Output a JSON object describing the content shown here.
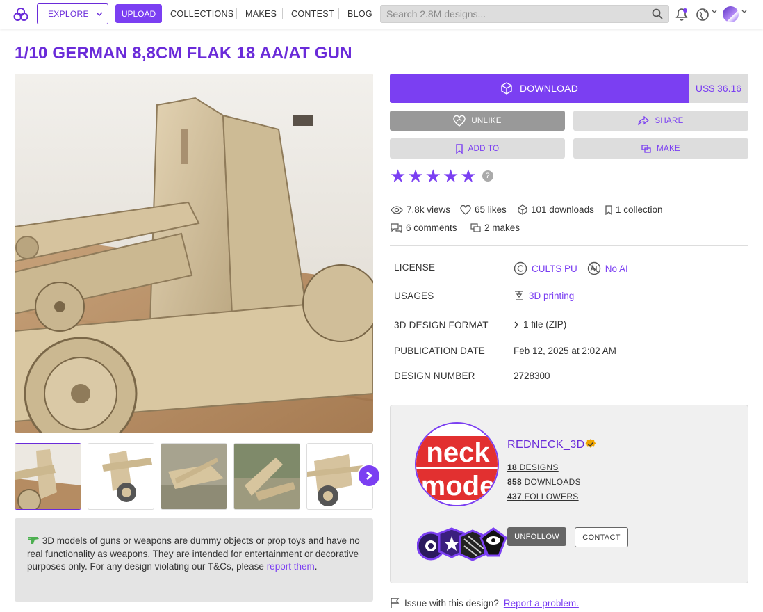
{
  "nav": {
    "explore": "EXPLORE",
    "upload": "UPLOAD",
    "links": [
      "COLLECTIONS",
      "MAKES",
      "CONTEST",
      "BLOG"
    ],
    "search_placeholder": "Search 2.8M designs..."
  },
  "page": {
    "title": "1/10 GERMAN 8,8CM FLAK 18 AA/AT GUN"
  },
  "actions": {
    "download": "DOWNLOAD",
    "price": "US$ 36.16",
    "unlike": "UNLIKE",
    "share": "SHARE",
    "add_to": "ADD TO",
    "make": "MAKE"
  },
  "rating": {
    "stars": 5,
    "help": "?"
  },
  "stats": {
    "views": "7.8k views",
    "likes": "65 likes",
    "downloads": "101 downloads",
    "collections": "1 collection",
    "comments": "6 comments",
    "makes": "2 makes"
  },
  "specs": {
    "license_label": "LICENSE",
    "license_value": "CULTS PU",
    "license_ai": "No AI",
    "usages_label": "USAGES",
    "usages_value": "3D printing",
    "format_label": "3D DESIGN FORMAT",
    "format_value": "1 file (ZIP)",
    "pubdate_label": "PUBLICATION DATE",
    "pubdate_value": "Feb 12, 2025 at 2:02 AM",
    "number_label": "DESIGN NUMBER",
    "number_value": "2728300"
  },
  "creator": {
    "name": "REDNECK_3D",
    "designs_count": "18",
    "designs_label": "DESIGNS",
    "downloads_count": "858",
    "downloads_label": "DOWNLOADS",
    "followers_count": "437",
    "followers_label": "FOLLOWERS",
    "unfollow": "UNFOLLOW",
    "contact": "CONTACT",
    "avatar_text_top": "neck",
    "avatar_text_bottom": "mode"
  },
  "notice": {
    "text": "3D models of guns or weapons are dummy objects or prop toys and have no real functionality as weapons. They are intended for entertainment or decorative purposes only. For any design violating our T&Cs, please ",
    "link": "report them",
    "end": "."
  },
  "issue": {
    "text": "Issue with this design?",
    "link": "Report a problem."
  },
  "colors": {
    "accent": "#7b3ff2",
    "title": "#6a2bd9",
    "button_grey": "#dddddd",
    "unlike_grey": "#999999"
  }
}
